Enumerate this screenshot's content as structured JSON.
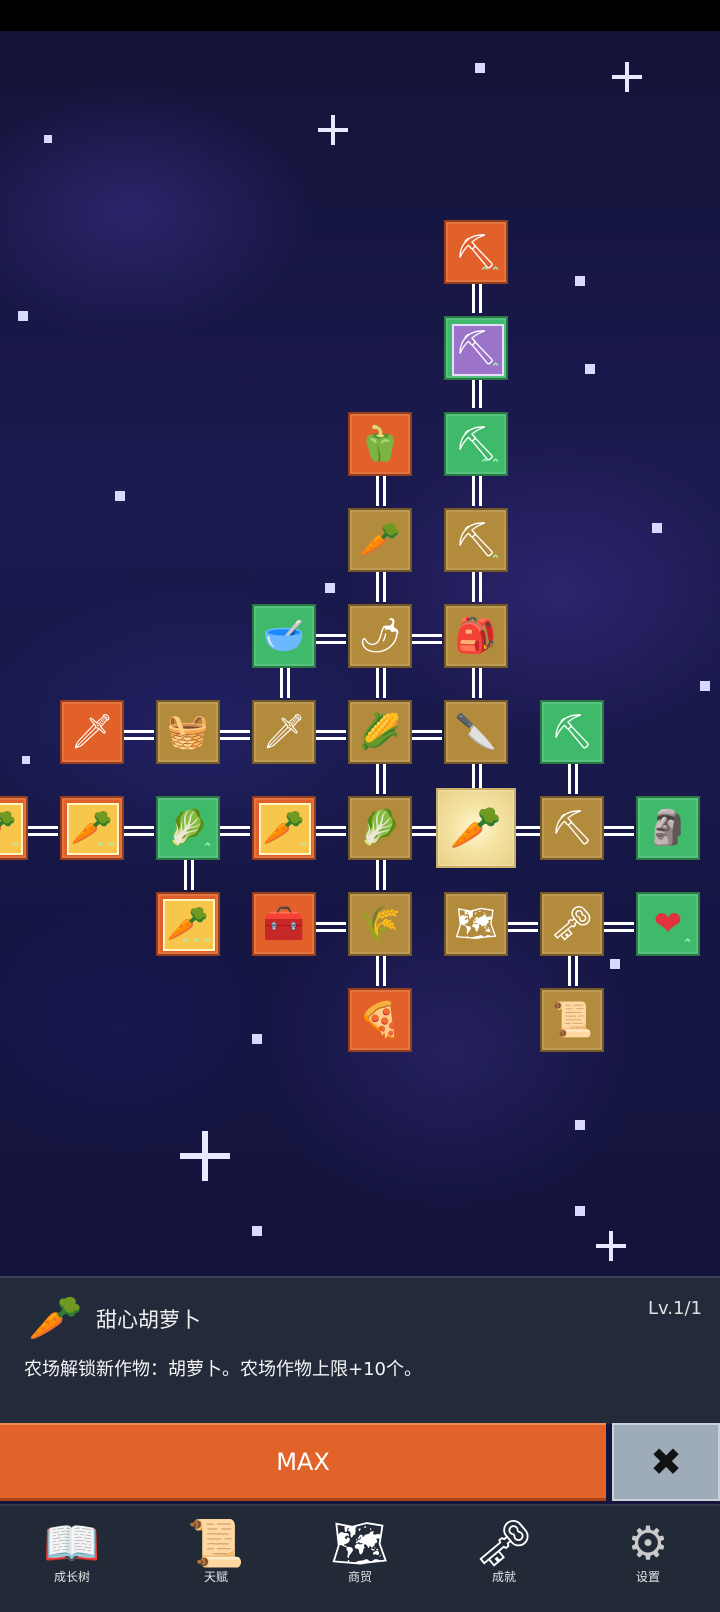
{
  "colors": {
    "orange": "#e2612a",
    "green": "#3fb96a",
    "brown": "#b38b3d",
    "purple": "#9b74c9",
    "panel": "#232b3a",
    "max_button": "#e2632a",
    "close_button": "#9eabb8"
  },
  "skill_tree": {
    "nodes": [
      {
        "id": "shovel-top",
        "icon": "shovel-icon",
        "glyph": "⛏",
        "badge": "⌃⌃"
      },
      {
        "id": "shovel-purple",
        "icon": "shovel-icon",
        "glyph": "⛏",
        "badge": "⌃"
      },
      {
        "id": "shovel-green",
        "icon": "shovel-icon",
        "glyph": "⛏",
        "badge": "⌃⌃"
      },
      {
        "id": "pepper",
        "icon": "bell-pepper-icon",
        "glyph": "🫑"
      },
      {
        "id": "radish",
        "icon": "radish-icon",
        "glyph": "🥕"
      },
      {
        "id": "shovel-brown",
        "icon": "shovel-icon",
        "glyph": "⛏",
        "badge": "⌃"
      },
      {
        "id": "bowl",
        "icon": "bowl-icon",
        "glyph": "🥣"
      },
      {
        "id": "chili",
        "icon": "chili-pepper-icon",
        "glyph": "🌶"
      },
      {
        "id": "backpack",
        "icon": "backpack-icon",
        "glyph": "🎒"
      },
      {
        "id": "sword-orange",
        "icon": "sword-icon",
        "glyph": "🗡"
      },
      {
        "id": "chest-brown",
        "icon": "chest-icon",
        "glyph": "🧺"
      },
      {
        "id": "sword-brown",
        "icon": "sword-icon",
        "glyph": "🗡"
      },
      {
        "id": "corn",
        "icon": "corn-icon",
        "glyph": "🌽"
      },
      {
        "id": "knife",
        "icon": "knife-icon",
        "glyph": "🔪"
      },
      {
        "id": "pickaxe-green",
        "icon": "pickaxe-icon",
        "glyph": "⛏"
      },
      {
        "id": "carrot-edge",
        "icon": "carrot-icon",
        "glyph": "🥕",
        "badge": "⌃"
      },
      {
        "id": "carrot-2",
        "icon": "carrot-icon",
        "glyph": "🥕",
        "badge": "⌃⌃"
      },
      {
        "id": "cabbage-green",
        "icon": "cabbage-icon",
        "glyph": "🥬",
        "badge": "⌃"
      },
      {
        "id": "carrot-3",
        "icon": "carrot-icon",
        "glyph": "🥕",
        "badge": "⌃"
      },
      {
        "id": "cabbage-brown",
        "icon": "cabbage-icon",
        "glyph": "🥬"
      },
      {
        "id": "carrot-center",
        "icon": "carrot-icon",
        "glyph": "🥕"
      },
      {
        "id": "pickaxe-brown",
        "icon": "pickaxe-icon",
        "glyph": "⛏"
      },
      {
        "id": "statue",
        "icon": "statue-icon",
        "glyph": "🗿"
      },
      {
        "id": "carrot-4",
        "icon": "carrot-icon",
        "glyph": "🥕",
        "badge": "⌃⌃⌃"
      },
      {
        "id": "treasure-chest",
        "icon": "treasure-chest-icon",
        "glyph": "🧰"
      },
      {
        "id": "wheat",
        "icon": "wheat-icon",
        "glyph": "🌾"
      },
      {
        "id": "map",
        "icon": "map-icon",
        "glyph": "🗺"
      },
      {
        "id": "key",
        "icon": "key-icon",
        "glyph": "🗝"
      },
      {
        "id": "heart",
        "icon": "heart-icon",
        "glyph": "❤",
        "badge": "⌃"
      },
      {
        "id": "pizza",
        "icon": "pizza-icon",
        "glyph": "🍕"
      },
      {
        "id": "scroll",
        "icon": "scroll-icon",
        "glyph": "📜"
      }
    ]
  },
  "detail_panel": {
    "icon": "carrot-icon",
    "icon_glyph": "🥕",
    "title": "甜心胡萝卜",
    "level": "Lv.1/1",
    "description": "农场解锁新作物：胡萝卜。农场作物上限+10个。"
  },
  "actions": {
    "max_label": "MAX",
    "close_glyph": "✖"
  },
  "bottom_nav": {
    "items": [
      {
        "label": "成长树",
        "icon": "book-icon",
        "glyph": "📖"
      },
      {
        "label": "天赋",
        "icon": "scroll-icon",
        "glyph": "📜"
      },
      {
        "label": "商贸",
        "icon": "map-icon",
        "glyph": "🗺"
      },
      {
        "label": "成就",
        "icon": "key-icon",
        "glyph": "🗝"
      },
      {
        "label": "设置",
        "icon": "gear-icon",
        "glyph": "⚙"
      }
    ]
  }
}
